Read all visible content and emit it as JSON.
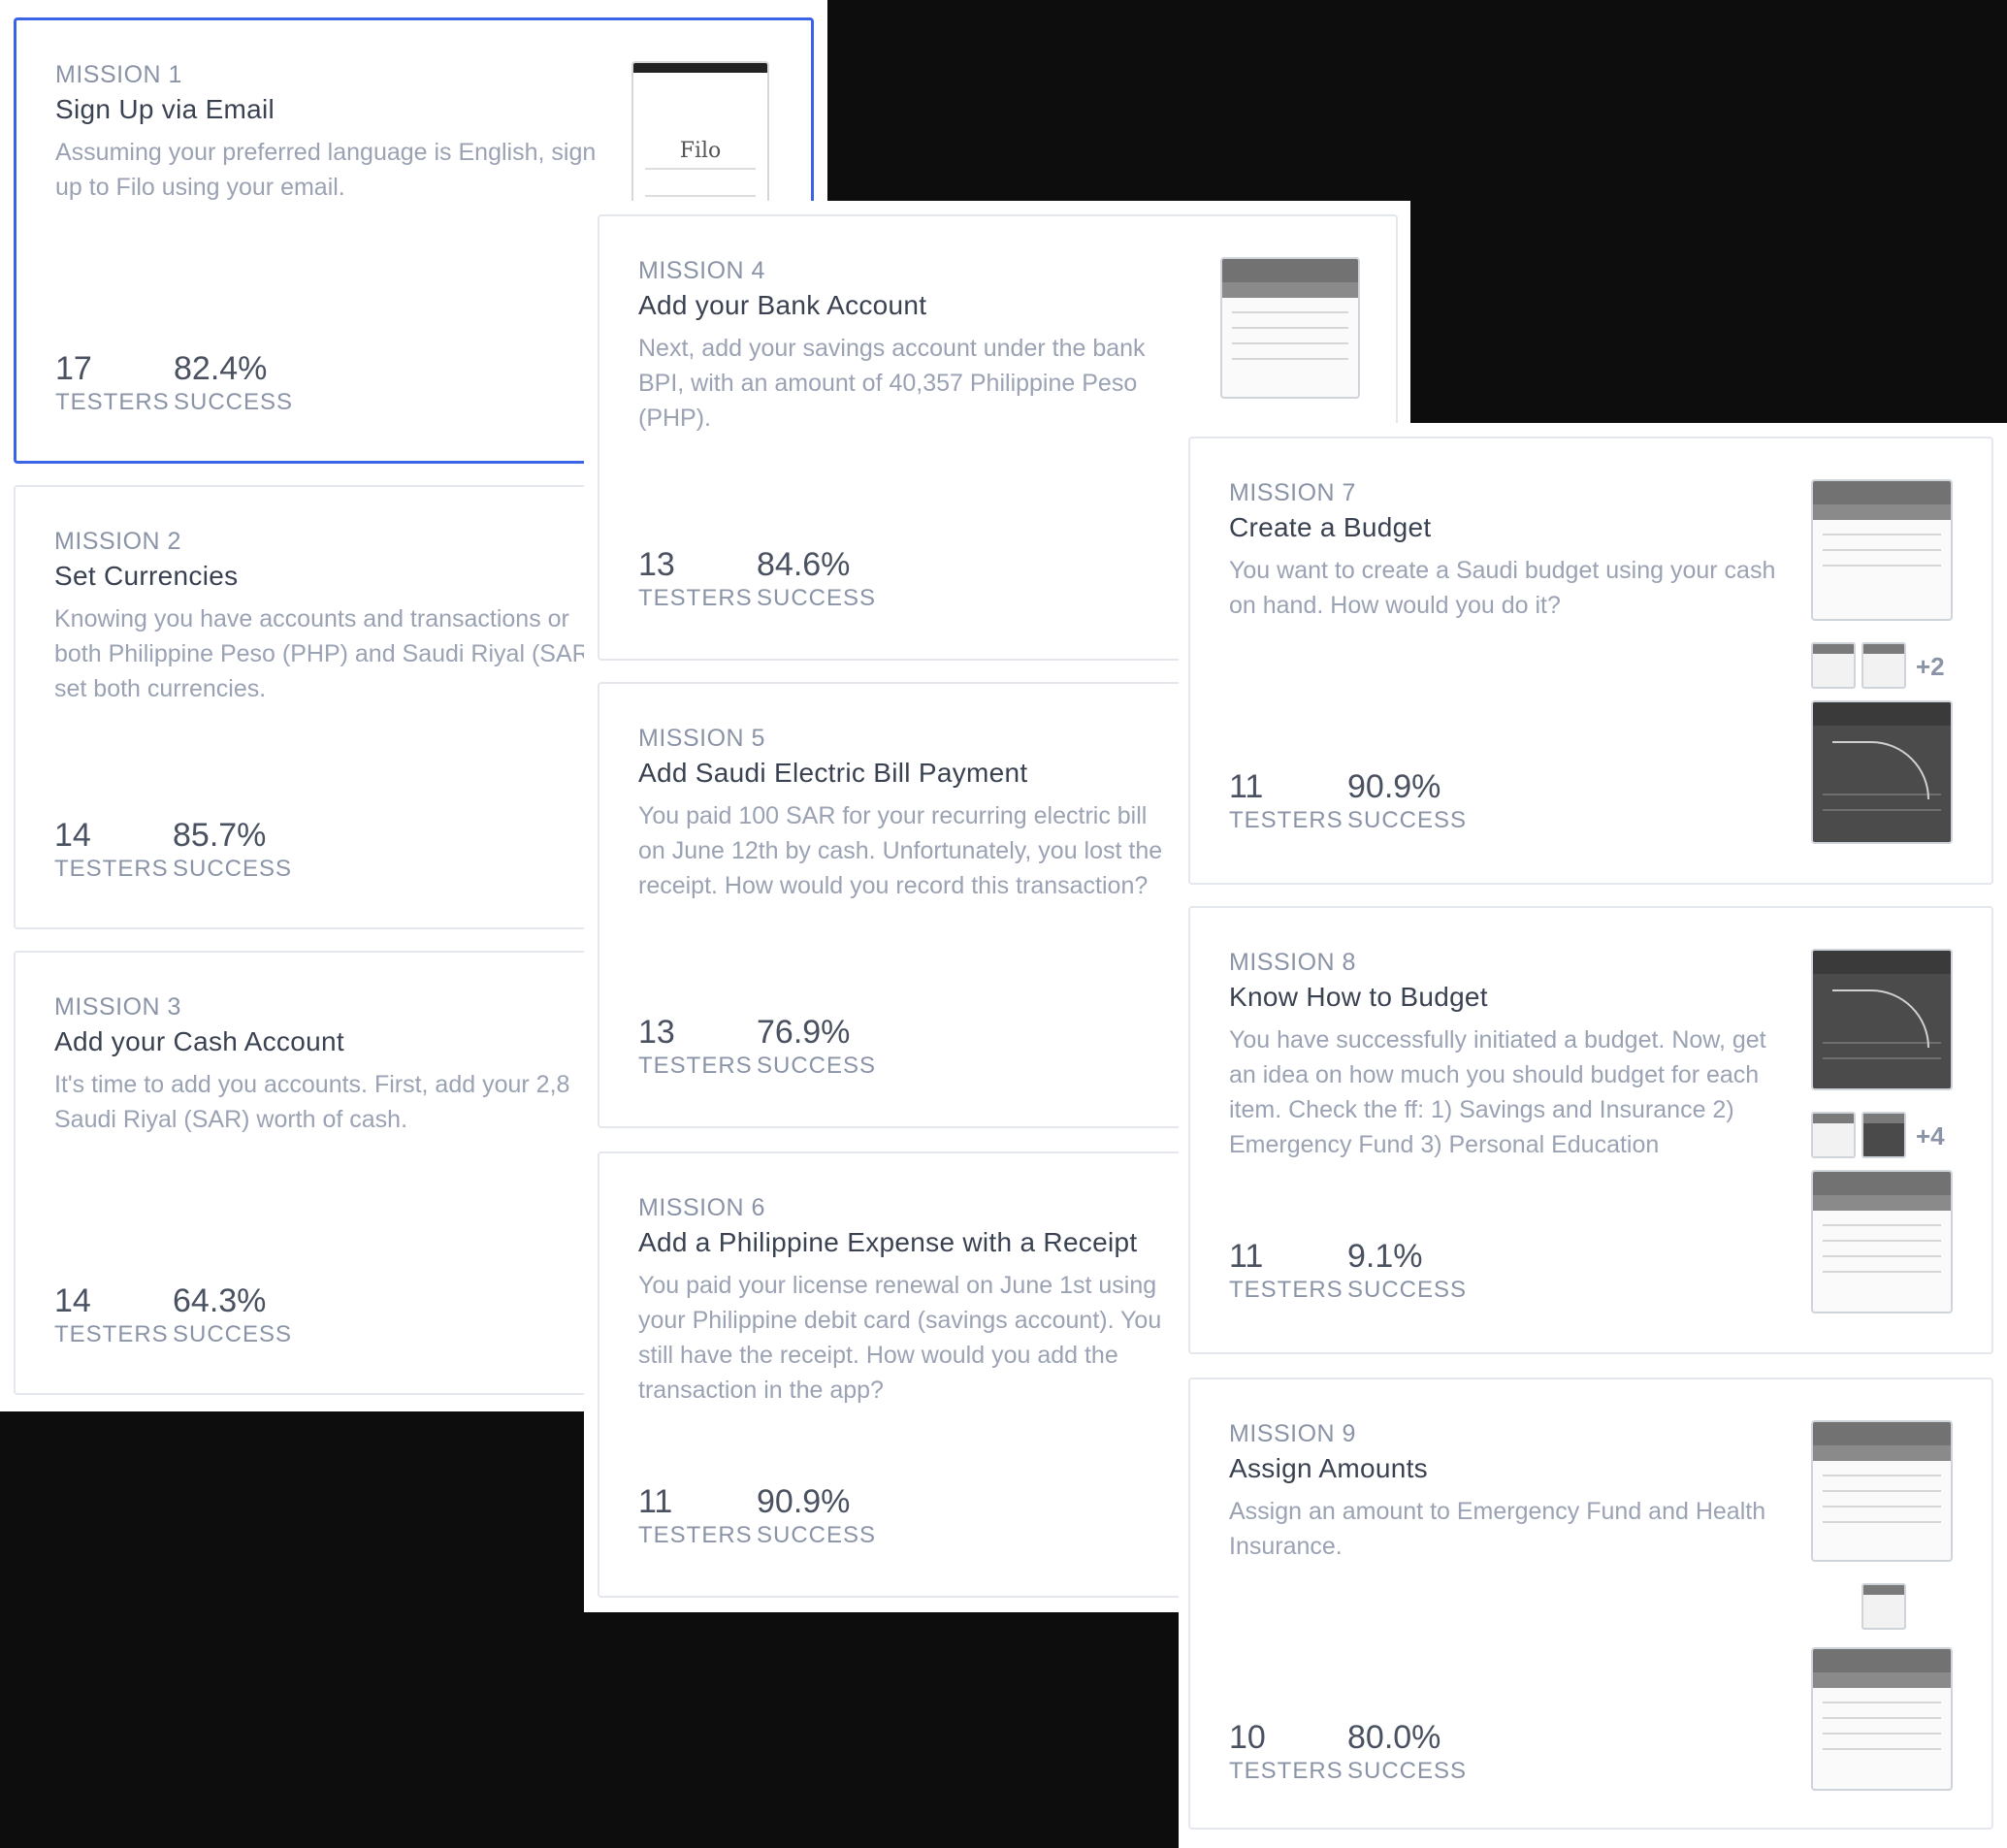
{
  "labels": {
    "testers": "TESTERS",
    "success": "SUCCESS"
  },
  "missions": [
    {
      "label": "MISSION 1",
      "title": "Sign Up via Email",
      "description": "Assuming your preferred language is English, sign\nup to Filo using your email.",
      "testers": "17",
      "success": "82.4%",
      "thumbnail_text": "Filo"
    },
    {
      "label": "MISSION 2",
      "title": "Set Currencies",
      "description": "Knowing you have accounts and transactions or\nboth Philippine Peso (PHP) and Saudi Riyal (SAR\nset both currencies.",
      "testers": "14",
      "success": "85.7%"
    },
    {
      "label": "MISSION 3",
      "title": "Add your Cash Account",
      "description": "It's time to add you accounts. First, add your 2,8\nSaudi Riyal (SAR) worth of cash.",
      "testers": "14",
      "success": "64.3%"
    },
    {
      "label": "MISSION 4",
      "title": "Add your Bank Account",
      "description": "Next, add your savings account under the bank\nBPI, with an amount of 40,357 Philippine Peso\n(PHP).",
      "testers": "13",
      "success": "84.6%"
    },
    {
      "label": "MISSION 5",
      "title": "Add Saudi Electric Bill Payment",
      "description": "You paid 100 SAR for your recurring electric bill\non June 12th by cash. Unfortunately, you lost the\nreceipt. How would you record this transaction?",
      "testers": "13",
      "success": "76.9%"
    },
    {
      "label": "MISSION 6",
      "title": "Add a Philippine Expense with a Receipt",
      "description": "You paid your license renewal on June 1st using\nyour Philippine debit card (savings account). You\nstill have the receipt. How would you add the\ntransaction in the app?",
      "testers": "11",
      "success": "90.9%"
    },
    {
      "label": "MISSION 7",
      "title": "Create a Budget",
      "description": "You want to create a Saudi budget using your cash\non hand. How would you do it?",
      "testers": "11",
      "success": "90.9%",
      "extra_screens": "+2"
    },
    {
      "label": "MISSION 8",
      "title": "Know How to Budget",
      "description": "You have successfully initiated a budget. Now, get\nan idea on how much you should budget for each\nitem. Check the ff: 1) Savings and Insurance 2)\nEmergency Fund 3) Personal Education",
      "testers": "11",
      "success": "9.1%",
      "extra_screens": "+4"
    },
    {
      "label": "MISSION 9",
      "title": "Assign Amounts",
      "description": "Assign an amount to Emergency Fund and Health\nInsurance.",
      "testers": "10",
      "success": "80.0%"
    }
  ],
  "colors": {
    "selected_border": "#3b63e6",
    "card_border": "#e4e7ee",
    "backdrop": "#0d0d0d"
  }
}
